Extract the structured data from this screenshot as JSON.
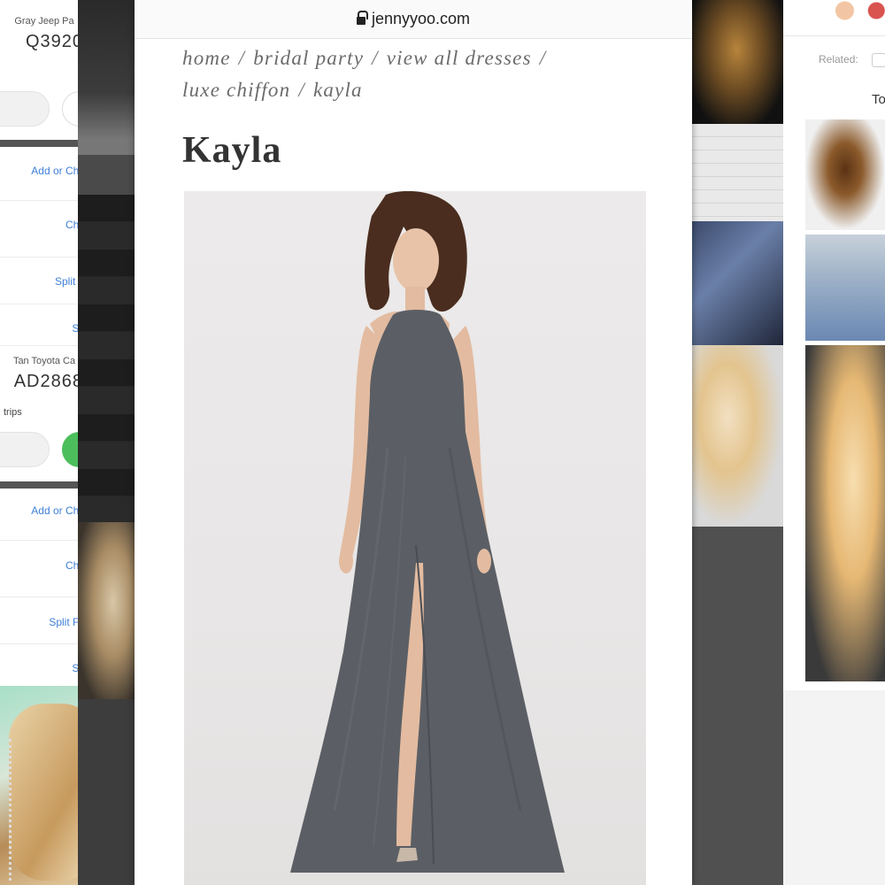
{
  "browser": {
    "url": "jennyyoo.com",
    "lock_icon": "lock-icon"
  },
  "breadcrumb": {
    "items": [
      "home",
      "bridal party",
      "view all dresses",
      "luxe chiffon",
      "kayla"
    ],
    "separator": "/"
  },
  "product": {
    "title": "Kayla",
    "image_icon": "dress-photo",
    "dress_color": "#5b5f65"
  },
  "background_left": {
    "car1": "Gray Jeep Pa",
    "plate1": "Q3920",
    "link_add": "Add or Cha",
    "link_change": "Cha",
    "link_split": "Split F",
    "link_share": "Sh",
    "car2": "Tan Toyota Ca",
    "plate2": "AD2868",
    "trips": "trips",
    "link_add2": "Add or Cha",
    "link_change2": "Cha",
    "link_split2": "Split Fa",
    "link_share2": "Sh"
  },
  "background_right": {
    "related_label": "Related:",
    "heading_fragment": "To"
  },
  "colors": {
    "accent_link": "#3f7fd6",
    "breadcrumb_text": "#6b6b6b",
    "title_text": "#333333",
    "green_button": "#4cbe5c"
  }
}
